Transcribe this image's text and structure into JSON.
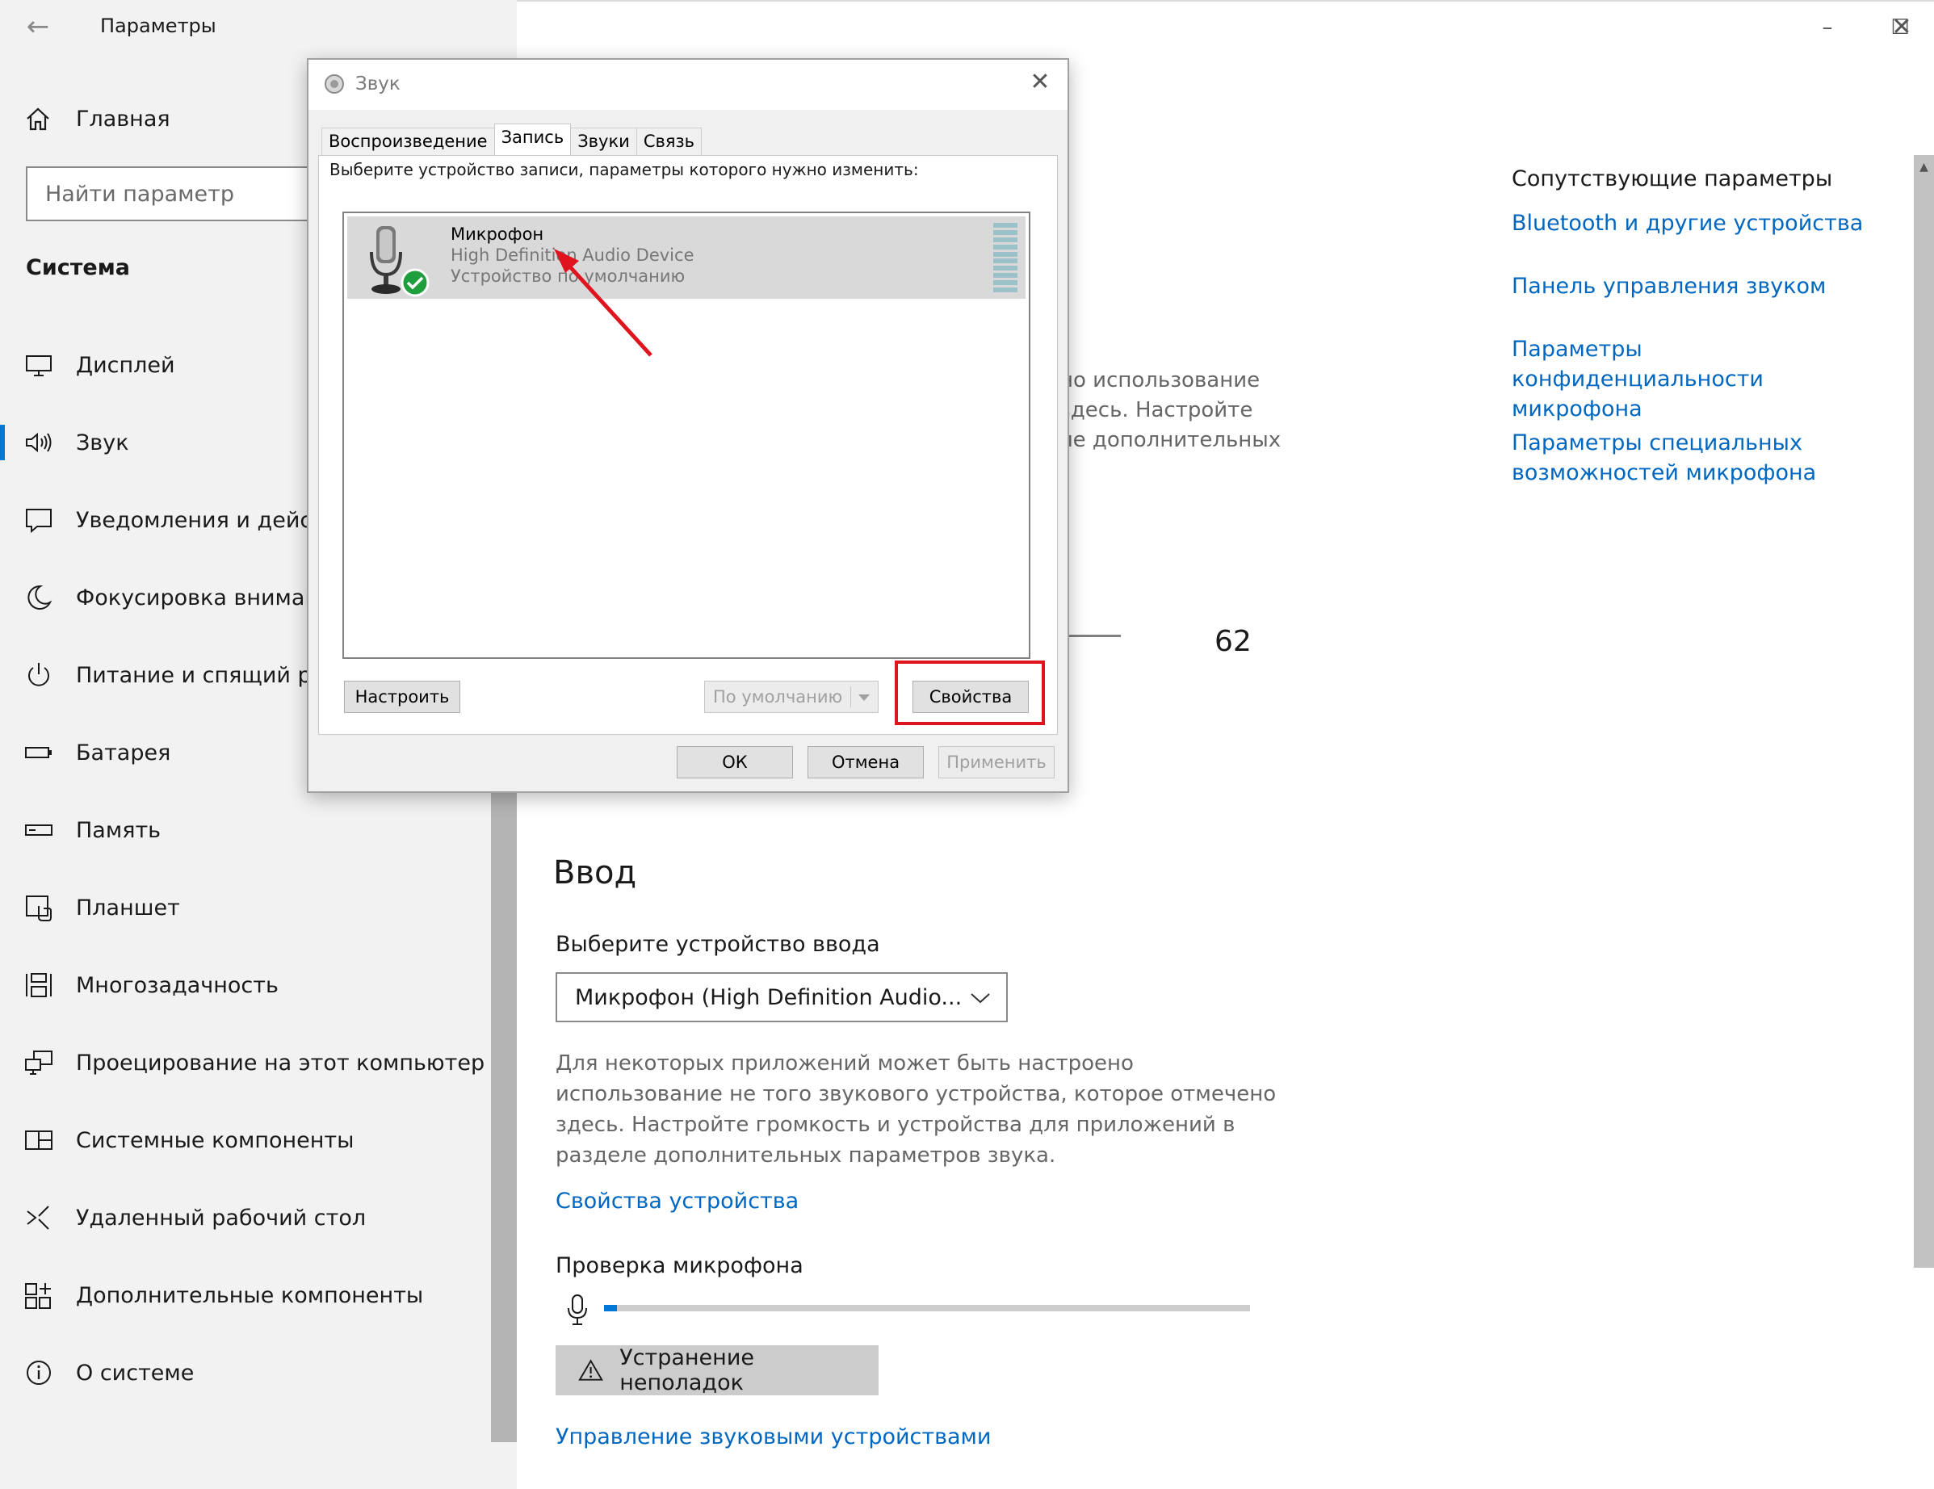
{
  "settings": {
    "title": "Параметры",
    "home_label": "Главная",
    "search_placeholder": "Найти параметр",
    "section": "Система",
    "nav": [
      {
        "label": "Дисплей",
        "icon": "display-icon"
      },
      {
        "label": "Звук",
        "icon": "speaker-icon",
        "active": true
      },
      {
        "label": "Уведомления и действия",
        "icon": "notification-icon"
      },
      {
        "label": "Фокусировка внимания",
        "icon": "moon-icon"
      },
      {
        "label": "Питание и спящий режим",
        "icon": "power-icon"
      },
      {
        "label": "Батарея",
        "icon": "battery-icon"
      },
      {
        "label": "Память",
        "icon": "storage-icon"
      },
      {
        "label": "Планшет",
        "icon": "tablet-icon"
      },
      {
        "label": "Многозадачность",
        "icon": "multitasking-icon"
      },
      {
        "label": "Проецирование на этот компьютер",
        "icon": "project-icon"
      },
      {
        "label": "Системные компоненты",
        "icon": "components-icon"
      },
      {
        "label": "Удаленный рабочий стол",
        "icon": "remote-desktop-icon"
      },
      {
        "label": "Дополнительные компоненты",
        "icon": "optional-features-icon"
      },
      {
        "label": "О системе",
        "icon": "info-icon"
      }
    ]
  },
  "related": {
    "title": "Сопутствующие параметры",
    "links": [
      "Bluetooth и другие устройства",
      "Панель управления звуком",
      "Параметры конфиденциальности микрофона",
      "Параметры специальных возможностей микрофона"
    ]
  },
  "main": {
    "bg_lines": [
      "но использование",
      "здесь. Настройте",
      "ле дополнительных"
    ],
    "volume_value": "62",
    "input_heading": "Ввод",
    "choose_device_label": "Выберите устройство ввода",
    "selected_device": "Микрофон (High Definition Audio...",
    "info_text": "Для некоторых приложений может быть настроено использование не того звукового устройства, которое отмечено здесь. Настройте громкость и устройства для приложений в разделе дополнительных параметров звука.",
    "device_properties_link": "Свойства устройства",
    "mic_test_label": "Проверка микрофона",
    "mic_level": 0.02,
    "troubleshoot_label": "Устранение неполадок",
    "manage_devices_link": "Управление звуковыми устройствами"
  },
  "dialog": {
    "title": "Звук",
    "tabs": [
      "Воспроизведение",
      "Запись",
      "Звуки",
      "Связь"
    ],
    "active_tab": "Запись",
    "prompt": "Выберите устройство записи, параметры которого нужно изменить:",
    "device": {
      "name": "Микрофон",
      "driver": "High Definition Audio Device",
      "status": "Устройство по умолчанию"
    },
    "configure_btn": "Настроить",
    "default_btn": "По умолчанию",
    "properties_btn": "Свойства",
    "ok_btn": "ОК",
    "cancel_btn": "Отмена",
    "apply_btn": "Применить"
  },
  "colors": {
    "accent": "#0078d7",
    "link": "#0067c0",
    "annotation_red": "#e0141e",
    "default_check": "#1e9e3c"
  }
}
